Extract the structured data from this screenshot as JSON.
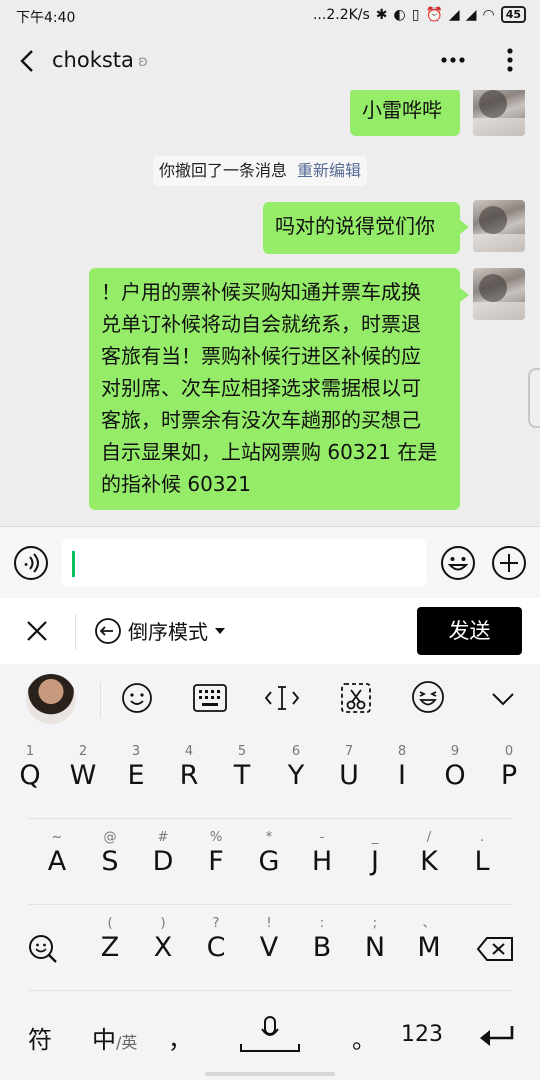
{
  "status_bar": {
    "time": "下午4:40",
    "net_speed": "...2.2K/s",
    "battery": "45"
  },
  "header": {
    "title": "choksta"
  },
  "messages": [
    {
      "type": "text",
      "side": "right",
      "text": "小雷哗哔"
    },
    {
      "type": "recall",
      "text": "你撤回了一条消息",
      "action": "重新编辑"
    },
    {
      "type": "text",
      "side": "right",
      "text": "吗对的说得觉们你"
    },
    {
      "type": "text",
      "side": "right",
      "lines": [
        "！户用的票补候买购知通并票车成换",
        "兑单订补候将动自会就统系，时票退",
        "客旅有当！票购补候行进区补候的应",
        "对别席、次车应相择选求需据根以可",
        "客旅，时票余有没次车趟那的买想己",
        "自示显果如，上站网票购 60321 在是",
        "的指补候 60321"
      ]
    }
  ],
  "ime": {
    "mode_label": "倒序模式",
    "send_label": "发送",
    "letters_row1": [
      "Q",
      "W",
      "E",
      "R",
      "T",
      "Y",
      "U",
      "I",
      "O",
      "P"
    ],
    "hints_row1": [
      "1",
      "2",
      "3",
      "4",
      "5",
      "6",
      "7",
      "8",
      "9",
      "0"
    ],
    "letters_row2": [
      "A",
      "S",
      "D",
      "F",
      "G",
      "H",
      "J",
      "K",
      "L"
    ],
    "hints_row2": [
      "~",
      "@",
      "#",
      "%",
      "*",
      "-",
      "_",
      "/",
      "."
    ],
    "letters_row3": [
      "Z",
      "X",
      "C",
      "V",
      "B",
      "N",
      "M"
    ],
    "hints_row3": [
      "(",
      ")",
      "?",
      "!",
      ":",
      ";",
      "、"
    ],
    "fn": {
      "symbols": "符",
      "lang_main": "中",
      "lang_alt": "/英",
      "comma": "，",
      "period": "。",
      "numbers": "123"
    }
  }
}
